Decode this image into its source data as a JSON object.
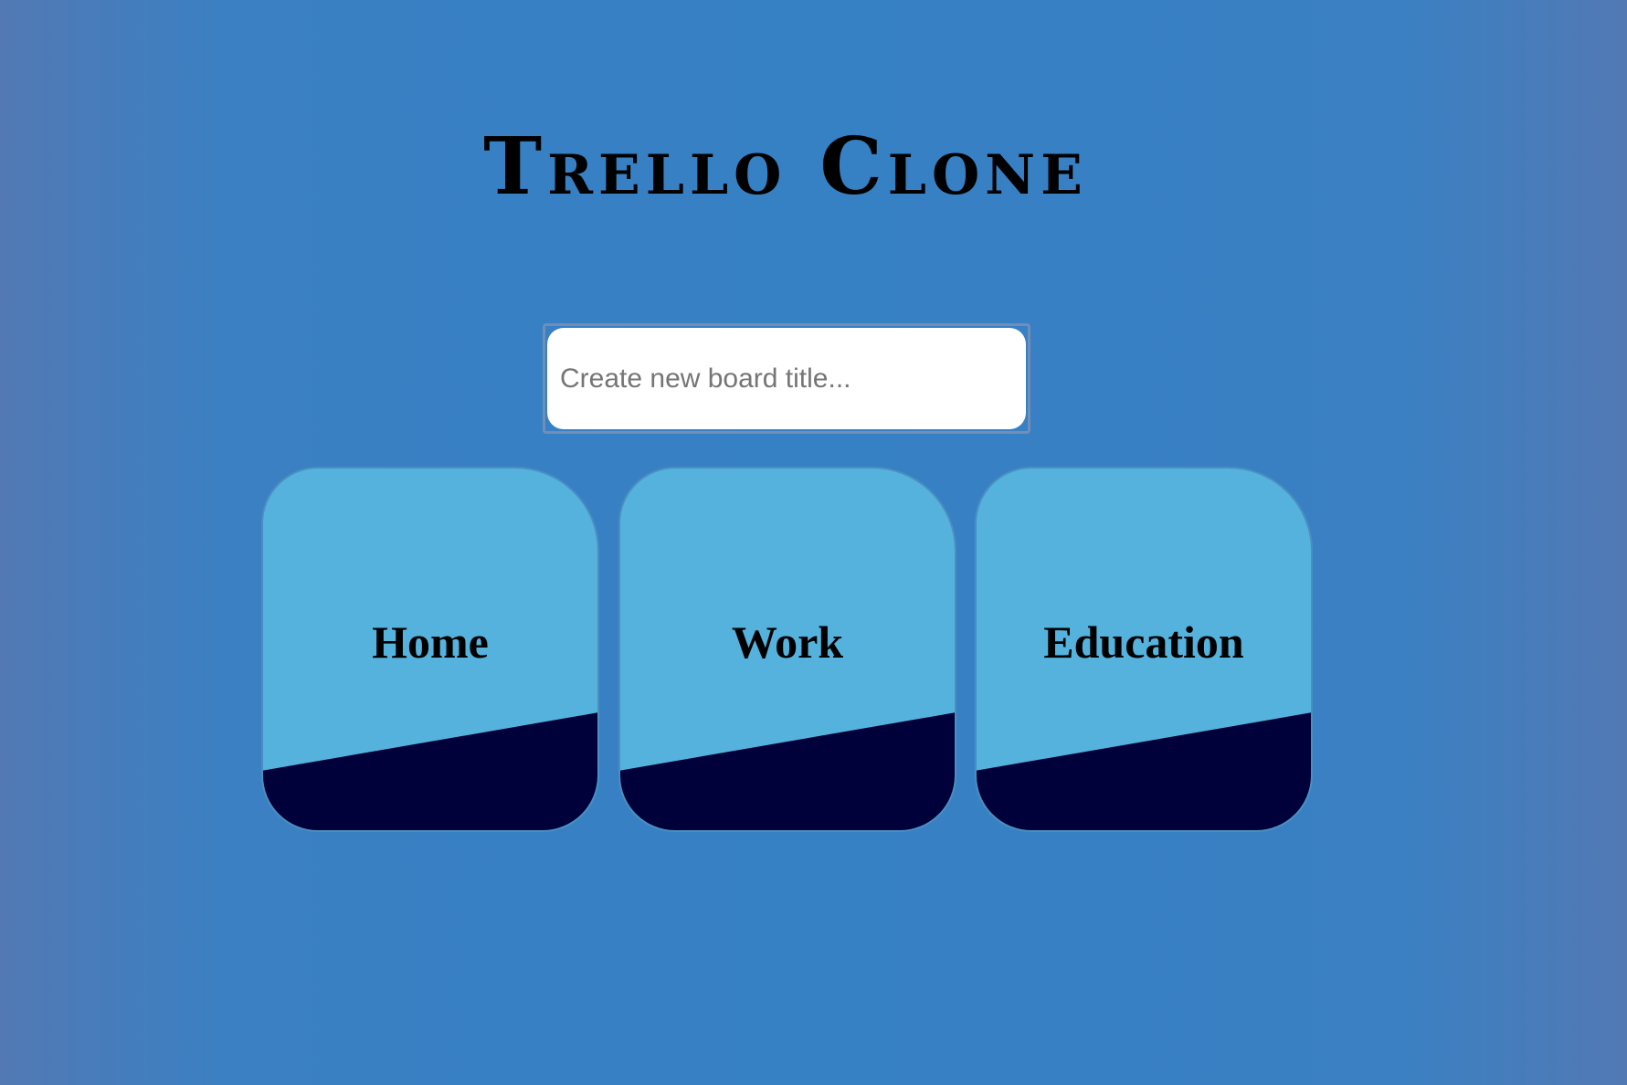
{
  "app": {
    "title": "Trello Clone"
  },
  "create_board": {
    "placeholder": "Create new board title...",
    "value": ""
  },
  "boards": [
    {
      "name": "Home"
    },
    {
      "name": "Work"
    },
    {
      "name": "Education"
    }
  ],
  "colors": {
    "background": "#3680c4",
    "background_edge": "#5279b4",
    "card": "#54b2dc",
    "card_accent": "#00003a",
    "input_background": "#ffffff",
    "text": "#000000"
  }
}
